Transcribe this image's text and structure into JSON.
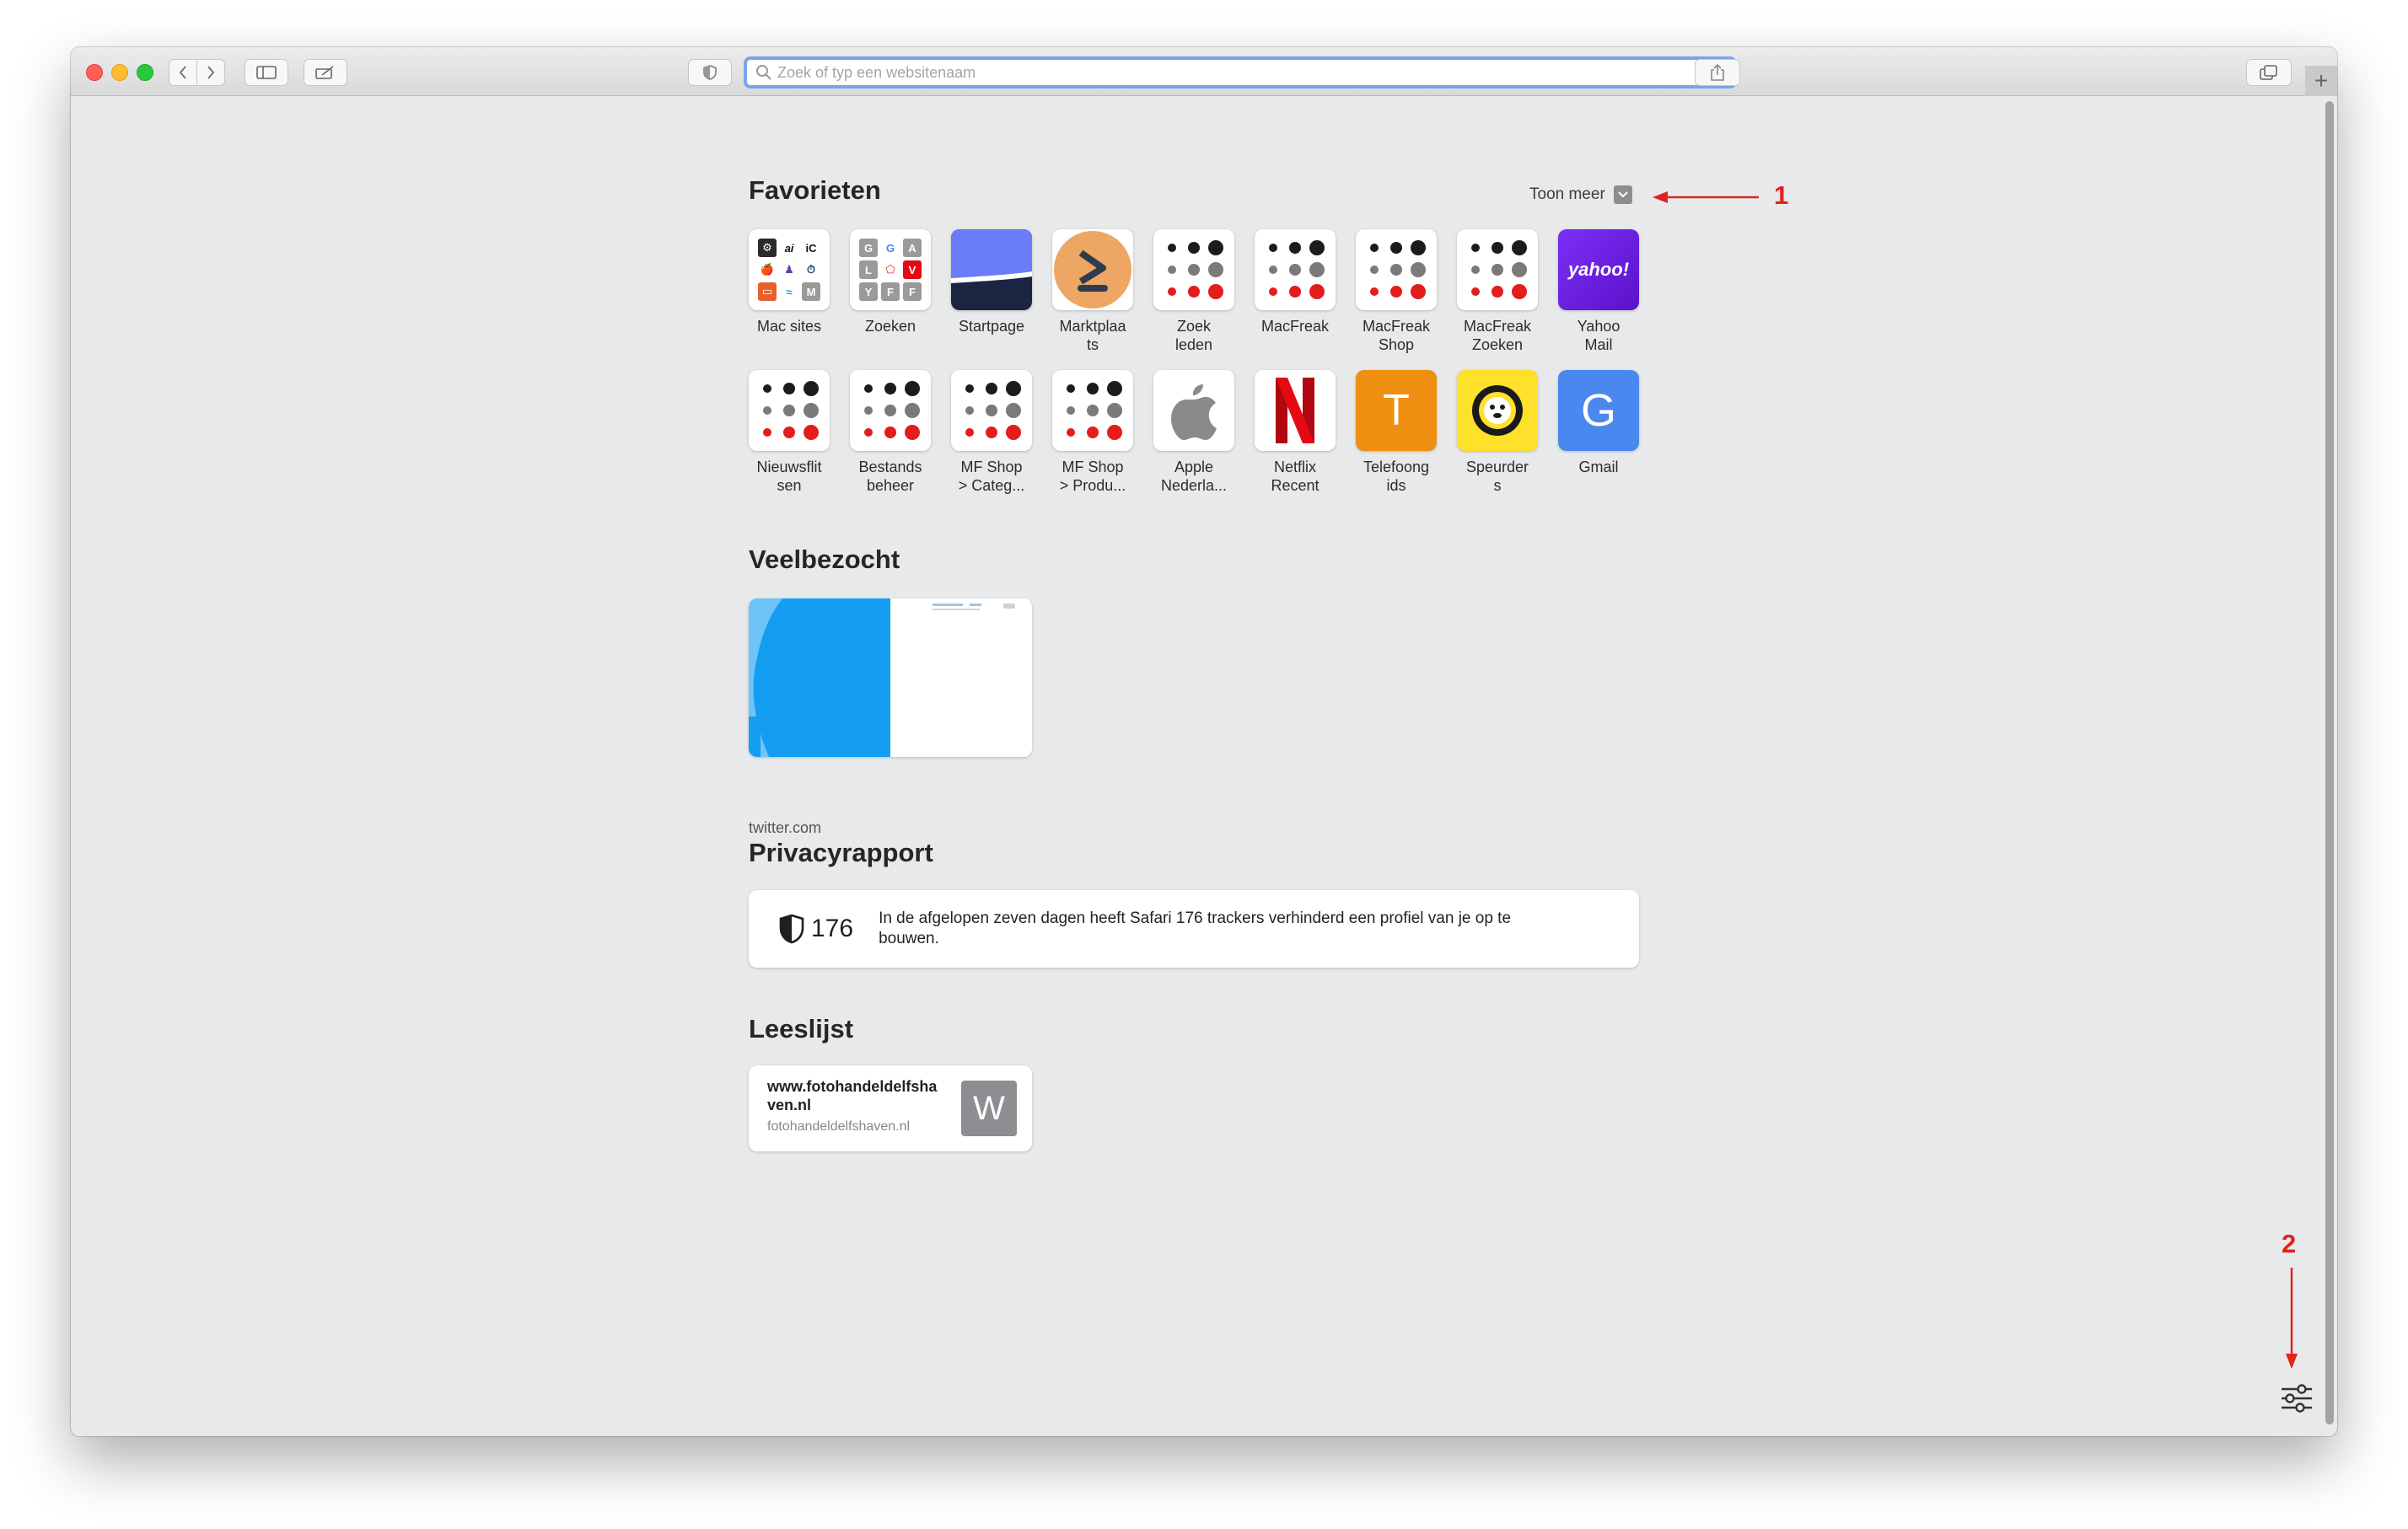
{
  "browser": {
    "address_placeholder": "Zoek of typ een websitenaam"
  },
  "sections": {
    "favorites_title": "Favorieten",
    "show_more_label": "Toon meer",
    "frequently_visited_title": "Veelbezocht",
    "privacy_title": "Privacyrapport",
    "reading_list_title": "Leeslijst"
  },
  "favorites": [
    {
      "label": "Mac sites",
      "icon": "folder-grid-icon"
    },
    {
      "label": "Zoeken",
      "icon": "folder-grid-icon"
    },
    {
      "label": "Startpage",
      "icon": "startpage-icon"
    },
    {
      "label": "Marktplaa\nts",
      "icon": "marktplaats-icon"
    },
    {
      "label": "Zoek\nleden",
      "icon": "macfreak-dots-icon"
    },
    {
      "label": "MacFreak",
      "icon": "macfreak-dots-icon"
    },
    {
      "label": "MacFreak\nShop",
      "icon": "macfreak-dots-icon"
    },
    {
      "label": "MacFreak\nZoeken",
      "icon": "macfreak-dots-icon"
    },
    {
      "label": "Yahoo\nMail",
      "icon": "yahoo-icon",
      "tile_text": "yahoo!"
    },
    {
      "label": "Nieuwsflit\nsen",
      "icon": "macfreak-dots-icon"
    },
    {
      "label": "Bestands\nbeheer",
      "icon": "macfreak-dots-icon"
    },
    {
      "label": "MF Shop\n> Categ...",
      "icon": "macfreak-dots-icon"
    },
    {
      "label": "MF Shop\n> Produ...",
      "icon": "macfreak-dots-icon"
    },
    {
      "label": "Apple\nNederla...",
      "icon": "apple-logo-icon"
    },
    {
      "label": "Netflix\nRecent",
      "icon": "netflix-icon",
      "tile_text": "N"
    },
    {
      "label": "Telefoong\nids",
      "icon": "letter-t-icon",
      "tile_text": "T"
    },
    {
      "label": "Speurder\ns",
      "icon": "speurders-icon"
    },
    {
      "label": "Gmail",
      "icon": "letter-g-icon",
      "tile_text": "G"
    }
  ],
  "mac_sites_folder": [
    "⚙",
    "ai",
    "iC",
    "🍎",
    "♟",
    "⏱",
    "▭",
    "≈",
    "M"
  ],
  "search_folder": [
    "G",
    "G",
    "A",
    "L",
    "⬠",
    "V",
    "Y",
    "F",
    "F"
  ],
  "frequently_visited": {
    "caption": "twitter.com"
  },
  "privacy": {
    "tracker_count": "176",
    "text": "In de afgelopen zeven dagen heeft Safari 176 trackers verhinderd een profiel van je op te bouwen."
  },
  "reading_list": {
    "title": "www.fotohandeldelfsha ven.nl",
    "subtitle": "fotohandeldelfshaven.nl",
    "icon_letter": "W"
  },
  "annotations": {
    "first": "1",
    "second": "2"
  },
  "colors": {
    "annotation_red": "#e0241b",
    "address_focus": "#76a6e8",
    "twitter_blue": "#1da1f2",
    "netflix_red": "#e50914",
    "gmail_blue": "#4285f4",
    "yahoo_purple": "#6001d2"
  }
}
